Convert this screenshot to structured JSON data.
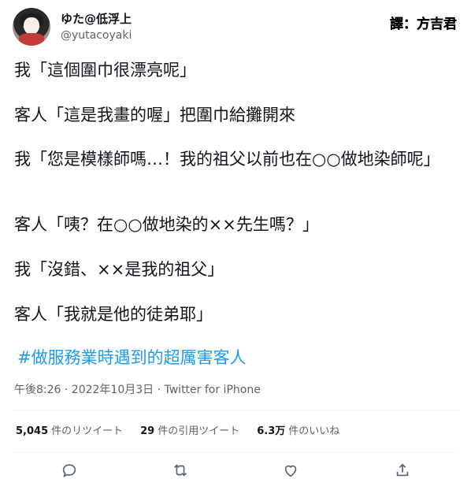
{
  "author": {
    "display_name": "ゆた@低浮上",
    "handle": "@yutacoyaki"
  },
  "credit": "譯：方吉君",
  "tweet": {
    "lines": [
      "我「這個圍巾很漂亮呢」",
      "客人「這是我畫的喔」把圍巾給攤開來",
      "我「您是模樣師嗎…！我的祖父以前也在○○做地染師呢」",
      "客人「咦？在○○做地染的××先生嗎？」",
      "我「沒錯、××是我的祖父」",
      "客人「我就是他的徒弟耶」"
    ],
    "hashtag": "#做服務業時遇到的超厲害客人"
  },
  "meta": "午後8:26 · 2022年10月3日 · Twitter for iPhone",
  "stats": {
    "retweets_count": "5,045",
    "retweets_label": "件のリツイート",
    "quotes_count": "29",
    "quotes_label": "件の引用ツイート",
    "likes_count": "6.3万",
    "likes_label": "件のいいね"
  },
  "actions": {
    "reply_icon": "reply-icon",
    "retweet_icon": "retweet-icon",
    "like_icon": "heart-icon",
    "share_icon": "share-icon"
  },
  "colors": {
    "text": "#0f1419",
    "secondary": "#536471",
    "link": "#1d9bf0"
  }
}
